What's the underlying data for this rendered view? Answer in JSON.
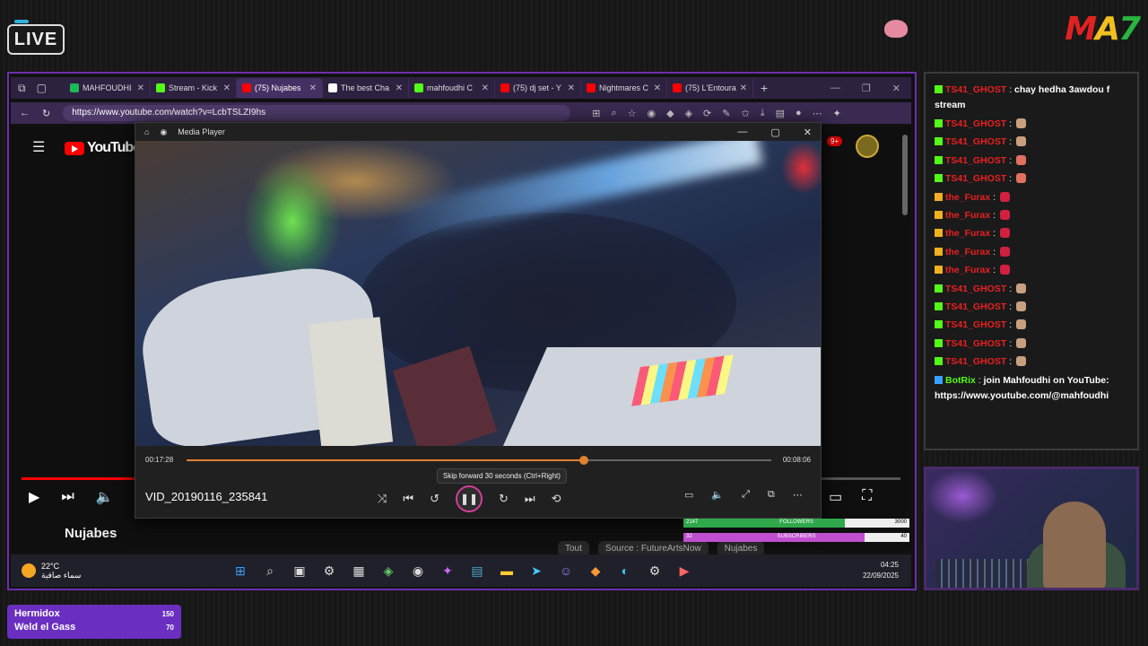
{
  "overlay": {
    "live": "LIVE",
    "logo": [
      "M",
      "A",
      "7"
    ]
  },
  "browser": {
    "tabs": [
      {
        "label": "MAHFOUDHI",
        "color": "#1db954",
        "active": false
      },
      {
        "label": "Stream - Kick",
        "color": "#53fc18",
        "active": false
      },
      {
        "label": "(75) Nujabes",
        "color": "#ff0000",
        "active": true
      },
      {
        "label": "The best Cha",
        "color": "#ffffff",
        "active": false
      },
      {
        "label": "mahfoudhi C",
        "color": "#53fc18",
        "active": false
      },
      {
        "label": "(75) dj set - Y",
        "color": "#ff0000",
        "active": false
      },
      {
        "label": "Nightmares C",
        "color": "#ff0000",
        "active": false
      },
      {
        "label": "(75) L'Entoura",
        "color": "#ff0000",
        "active": false
      }
    ],
    "new_tab": "+",
    "url": "https://www.youtube.com/watch?v=LcbTSLZI9hs"
  },
  "youtube": {
    "logo": "YouTube",
    "badge": "9+",
    "video_title": "Nujabes",
    "chips": [
      "Tout",
      "Source : FutureArtsNow",
      "Nujabes"
    ],
    "progress": 0.13
  },
  "player": {
    "title": "Media Player",
    "time_elapsed": "00:17:28",
    "time_remaining": "00:08:06",
    "progress": 0.68,
    "tooltip": "Skip forward 30 seconds (Ctrl+Right)",
    "filename": "VID_20190116_235841"
  },
  "goals": [
    {
      "value": "2147",
      "label": "FOLLOWERS",
      "target": "3000",
      "fraction": 0.716,
      "color": "#2ea84a"
    },
    {
      "value": "32",
      "label": "SUBSCRIBERS",
      "target": "40",
      "fraction": 0.8,
      "color": "#c04fd0"
    }
  ],
  "taskbar": {
    "temp": "22°C",
    "weather": "سماء صافية",
    "time": "04:25",
    "date": "22/09/2025"
  },
  "chat": [
    {
      "user": "TS41_GHOST",
      "color": "#e82020",
      "badge": "kick",
      "text": "chay hedha 3awdou f stream",
      "emote": null
    },
    {
      "user": "TS41_GHOST",
      "color": "#e82020",
      "badge": "kick",
      "text": "",
      "emote": "#c8a080"
    },
    {
      "user": "TS41_GHOST",
      "color": "#e82020",
      "badge": "kick",
      "text": "",
      "emote": "#c8a080"
    },
    {
      "user": "TS41_GHOST",
      "color": "#e82020",
      "badge": "kick",
      "text": "",
      "emote": "#e07060"
    },
    {
      "user": "TS41_GHOST",
      "color": "#e82020",
      "badge": "kick",
      "text": "",
      "emote": "#e07060"
    },
    {
      "user": "the_Furax",
      "color": "#e82020",
      "badge": "crown",
      "text": "",
      "emote": "#d02040"
    },
    {
      "user": "the_Furax",
      "color": "#e82020",
      "badge": "crown",
      "text": "",
      "emote": "#d02040"
    },
    {
      "user": "the_Furax",
      "color": "#e82020",
      "badge": "crown",
      "text": "",
      "emote": "#d02040"
    },
    {
      "user": "the_Furax",
      "color": "#e82020",
      "badge": "crown",
      "text": "",
      "emote": "#d02040"
    },
    {
      "user": "the_Furax",
      "color": "#e82020",
      "badge": "crown",
      "text": "",
      "emote": "#d02040"
    },
    {
      "user": "TS41_GHOST",
      "color": "#e82020",
      "badge": "kick",
      "text": "",
      "emote": "#c8a080"
    },
    {
      "user": "TS41_GHOST",
      "color": "#e82020",
      "badge": "kick",
      "text": "",
      "emote": "#c8a080"
    },
    {
      "user": "TS41_GHOST",
      "color": "#e82020",
      "badge": "kick",
      "text": "",
      "emote": "#c8a080"
    },
    {
      "user": "TS41_GHOST",
      "color": "#e82020",
      "badge": "kick",
      "text": "",
      "emote": "#c8a080"
    },
    {
      "user": "TS41_GHOST",
      "color": "#e82020",
      "badge": "kick",
      "text": "",
      "emote": "#c8a080"
    },
    {
      "user": "BotRix",
      "color": "#53fc18",
      "badge": "bot",
      "text": "join Mahfoudhi on YouTube: https://www.youtube.com/@mahfoudhi",
      "emote": null
    }
  ],
  "supporters": [
    {
      "name": "Hermidox",
      "value": "150"
    },
    {
      "name": "Weld el Gass",
      "value": "70"
    }
  ]
}
